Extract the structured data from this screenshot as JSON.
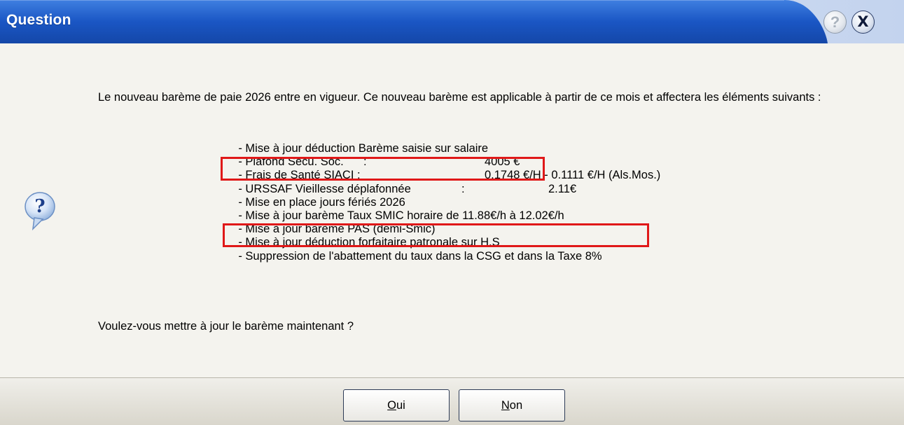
{
  "window": {
    "title": "Question",
    "help_label": "?",
    "close_label": "X"
  },
  "message": {
    "intro": "Le nouveau barème de paie 2026 entre en vigueur. Ce nouveau barème est applicable à partir de ce mois et affectera les éléments suivants :",
    "items": [
      {
        "label": "- Mise à jour déduction Barème saisie sur salaire",
        "sep": "",
        "value": ""
      },
      {
        "label": "- Plafond Sécu. Soc.",
        "sep": ":",
        "value": "4005 €"
      },
      {
        "label": "- Frais de Santé SIACI :",
        "sep": "",
        "value": "0.1748 €/H - 0.1111 €/H (Als.Mos.)"
      },
      {
        "label": "- URSSAF Vieillesse déplafonnée",
        "sep": ":",
        "value": "2.11€"
      },
      {
        "label": "- Mise en place jours fériés 2026",
        "sep": "",
        "value": ""
      },
      {
        "label": "- Mise à jour barème Taux SMIC horaire de 11.88€/h à 12.02€/h",
        "sep": "",
        "value": ""
      },
      {
        "label": "- Mise à jour barème PAS (demi-Smic)",
        "sep": "",
        "value": ""
      },
      {
        "label": "- Mise à jour déduction forfaitaire patronale sur H.S",
        "sep": "",
        "value": ""
      },
      {
        "label": "- Suppression de l'abattement du taux dans la CSG et dans la Taxe 8%",
        "sep": "",
        "value": ""
      }
    ],
    "question": "Voulez-vous mettre à jour le barème maintenant ?"
  },
  "buttons": {
    "yes": {
      "accel": "O",
      "rest": "ui"
    },
    "no": {
      "accel": "N",
      "rest": "on"
    }
  },
  "icons": {
    "question": "question-bubble-icon",
    "help": "help-icon",
    "close": "close-icon"
  },
  "colors": {
    "titlebar_blue": "#1f5bc8",
    "highlight_red": "#e01818",
    "content_bg": "#f4f3ee"
  }
}
